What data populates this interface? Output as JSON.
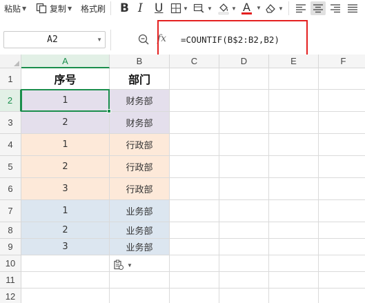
{
  "toolbar": {
    "paste_label": "粘贴",
    "copy_label": "复制",
    "format_painter_label": "格式刷",
    "bold_glyph": "B",
    "italic_glyph": "I",
    "underline_glyph": "U",
    "font_color_glyph": "A"
  },
  "formula_bar": {
    "name_box_value": "A2",
    "fx_label": "fx",
    "formula": "=COUNTIF(B$2:B2,B2)"
  },
  "columns": [
    "A",
    "B",
    "C",
    "D",
    "E",
    "F"
  ],
  "rows": [
    "1",
    "2",
    "3",
    "4",
    "5",
    "6",
    "7",
    "8",
    "9",
    "10",
    "11",
    "12"
  ],
  "header_row": {
    "a": "序号",
    "b": "部门"
  },
  "data_rows": [
    {
      "a": "1",
      "b": "财务部",
      "group": "finance"
    },
    {
      "a": "2",
      "b": "财务部",
      "group": "finance"
    },
    {
      "a": "1",
      "b": "行政部",
      "group": "admin"
    },
    {
      "a": "2",
      "b": "行政部",
      "group": "admin"
    },
    {
      "a": "3",
      "b": "行政部",
      "group": "admin"
    },
    {
      "a": "1",
      "b": "业务部",
      "group": "business"
    },
    {
      "a": "2",
      "b": "业务部",
      "group": "business"
    },
    {
      "a": "3",
      "b": "业务部",
      "group": "business"
    }
  ],
  "selection": {
    "cell": "A2",
    "column": "A",
    "row": "2"
  },
  "colors": {
    "finance_fill": "#e4dfec",
    "admin_fill": "#fde9d9",
    "business_fill": "#dce6f0",
    "selection_green": "#1a8e4c",
    "highlight_red": "#e41f1f"
  }
}
